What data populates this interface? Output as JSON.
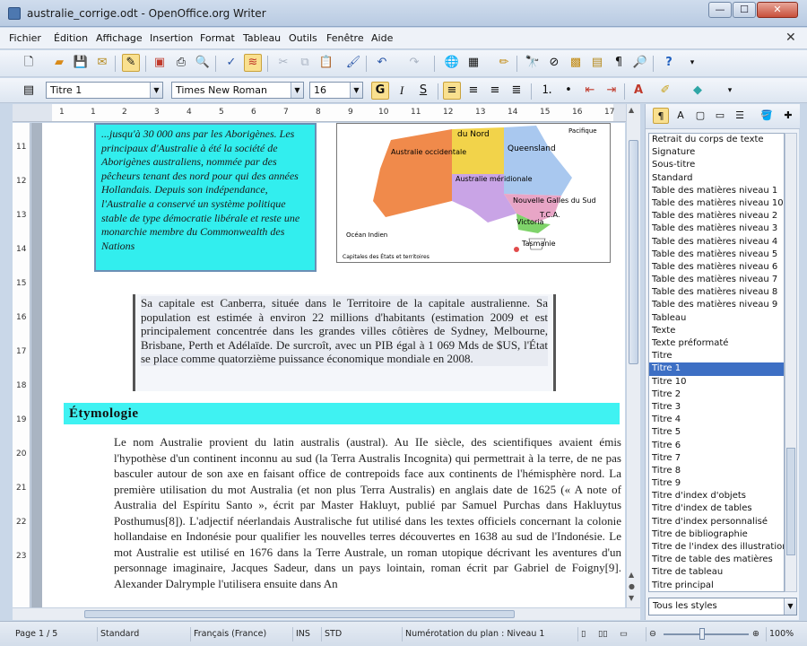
{
  "window": {
    "title": "australie_corrige.odt - OpenOffice.org Writer",
    "min_glyph": "—",
    "max_glyph": "☐",
    "close_glyph": "✕"
  },
  "menu": [
    "Fichier",
    "Édition",
    "Affichage",
    "Insertion",
    "Format",
    "Tableau",
    "Outils",
    "Fenêtre",
    "Aide"
  ],
  "formatting": {
    "style": "Titre 1",
    "font": "Times New Roman",
    "size": "16",
    "bold": "G",
    "italic": "I",
    "underline": "S"
  },
  "ruler": {
    "h_ticks": [
      "1",
      "1",
      "2",
      "3",
      "4",
      "5",
      "6",
      "7",
      "8",
      "9",
      "10",
      "11",
      "12",
      "13",
      "14",
      "15",
      "16",
      "17"
    ],
    "v_ticks": [
      "11",
      "12",
      "13",
      "14",
      "15",
      "16",
      "17",
      "18",
      "19",
      "20",
      "21",
      "22",
      "23"
    ]
  },
  "document": {
    "frame_text": "...jusqu'à 30 000 ans par les Aborigènes. Les principaux d'Australie à été la société de Aborigènes australiens, nommée par des pêcheurs tenant des nord pour qui des années Hollandais. Depuis son indépendance, l'Australie a conservé un système politique stable de type démocratie libérale et reste une monarchie membre du Commonwealth des Nations",
    "map_labels": {
      "nt": "du Nord",
      "wa": "Australie occidentale",
      "qld": "Queensland",
      "sa": "Australie méridionale",
      "nsw": "Nouvelle Galles du Sud",
      "vic": "Victoria",
      "tas": "Tasmanie",
      "act": "T.C.A.",
      "pacific": "Pacifique",
      "indian": "Océan Indien",
      "legend": "Capitales des États et territoires"
    },
    "capital_paragraph": "Sa capitale est Canberra, située dans le Territoire de la capitale australienne. Sa population est estimée à environ 22 millions d'habitants (estimation 2009 et est principalement concentrée dans les grandes villes côtières de Sydney, Melbourne, Brisbane, Perth et Adélaïde. De surcroît, avec un PIB égal à 1 069 Mds de $US, l'État se place comme quatorzième puissance économique mondiale en 2008.",
    "heading": "Étymologie",
    "etymology_text": "Le nom Australie provient du latin australis (austral). Au IIe siècle, des scientifiques avaient émis l'hypothèse d'un continent inconnu au sud (la Terra Australis Incognita) qui permettrait à la terre, de ne pas basculer autour de son axe en faisant office de contrepoids face aux continents de l'hémisphère nord. La première utilisation du mot Australia (et non plus Terra Australis) en anglais date de 1625 (« A note of Australia del Espíritu Santo », écrit par Master Hakluyt, publié par Samuel Purchas dans Hakluytus Posthumus[8]). L'adjectif néerlandais Australische fut utilisé dans les textes officiels concernant la colonie hollandaise en Indonésie pour qualifier les nouvelles terres découvertes en 1638 au sud de l'Indonésie. Le mot Australie est utilisé en 1676 dans la Terre Australe, un roman utopique décrivant les aventures d'un personnage imaginaire, Jacques Sadeur, dans un pays lointain, roman écrit par Gabriel de Foigny[9]. Alexander Dalrymple l'utilisera ensuite dans An"
  },
  "styles": {
    "items": [
      "Retrait du corps de texte",
      "Signature",
      "Sous-titre",
      "Standard",
      "Table des matières niveau 1",
      "Table des matières niveau 10",
      "Table des matières niveau 2",
      "Table des matières niveau 3",
      "Table des matières niveau 4",
      "Table des matières niveau 5",
      "Table des matières niveau 6",
      "Table des matières niveau 7",
      "Table des matières niveau 8",
      "Table des matières niveau 9",
      "Tableau",
      "Texte",
      "Texte préformaté",
      "Titre",
      "Titre 1",
      "Titre 10",
      "Titre 2",
      "Titre 3",
      "Titre 4",
      "Titre 5",
      "Titre 6",
      "Titre 7",
      "Titre 8",
      "Titre 9",
      "Titre d'index d'objets",
      "Titre d'index de tables",
      "Titre d'index personnalisé",
      "Titre de bibliographie",
      "Titre de l'index des illustrations",
      "Titre de table des matières",
      "Titre de tableau",
      "Titre principal"
    ],
    "filter": "Tous les styles"
  },
  "status": {
    "page": "Page 1 / 5",
    "page_style": "Standard",
    "language": "Français (France)",
    "insert_mode": "INS",
    "selection_mode": "STD",
    "outline": "Numérotation du plan : Niveau 1",
    "zoom": "100%"
  },
  "colors": {
    "frame_bg": "#32eeee",
    "heading_bg": "#3ff2f2",
    "selection": "#3d6fc4"
  }
}
